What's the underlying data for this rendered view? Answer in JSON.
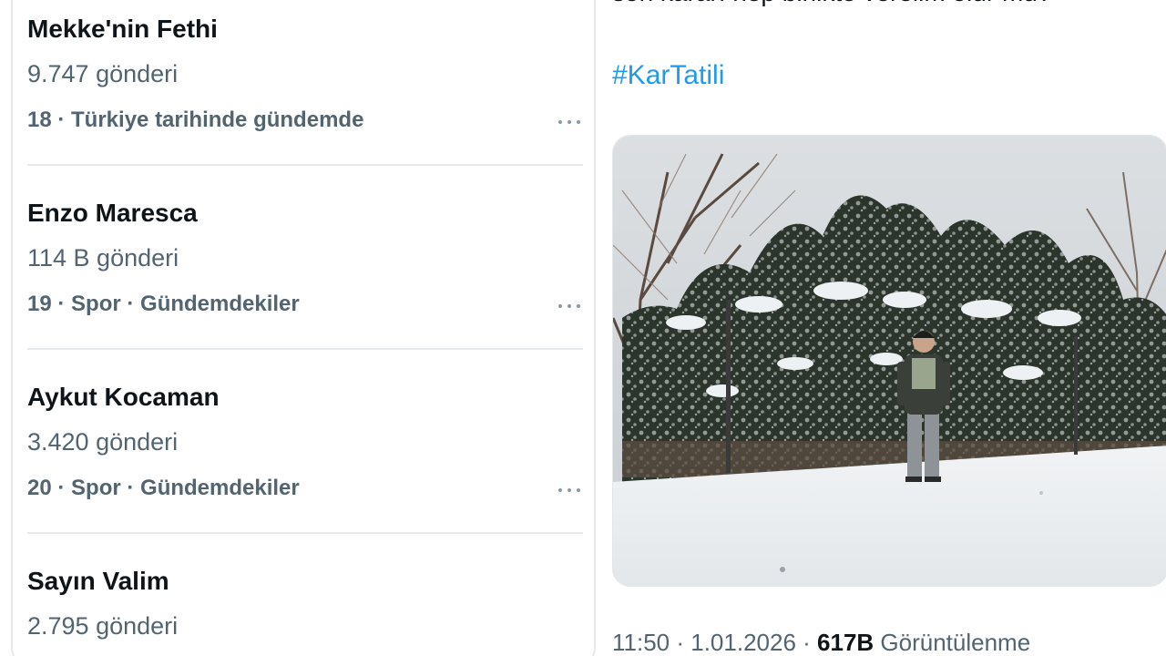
{
  "trends": [
    {
      "title": "Mekke'nin Fethi",
      "count": "9.747 gönderi",
      "meta": "18 · Türkiye tarihinde gündemde"
    },
    {
      "title": "Enzo Maresca",
      "count": "114 B gönderi",
      "meta": "19 · Spor · Gündemdekiler"
    },
    {
      "title": "Aykut Kocaman",
      "count": "3.420 gönderi",
      "meta": "20 · Spor · Gündemdekiler"
    },
    {
      "title": "Sayın Valim",
      "count": "2.795 gönderi",
      "meta": ""
    }
  ],
  "tweet": {
    "text_cut": "son kararı hep birlikte verelim olur mu?",
    "hashtag": "#KarTatili",
    "footer": {
      "time": "11:50",
      "sep1": " · ",
      "date": "1.01.2026",
      "sep2": " · ",
      "views_count": "617B",
      "views_label": " Görüntülenme"
    }
  },
  "colors": {
    "link": "#1d9bf0",
    "secondary_text": "#536471",
    "primary_text": "#0f1419"
  },
  "icons": {
    "trend_more": "more-horizontal-icon"
  }
}
